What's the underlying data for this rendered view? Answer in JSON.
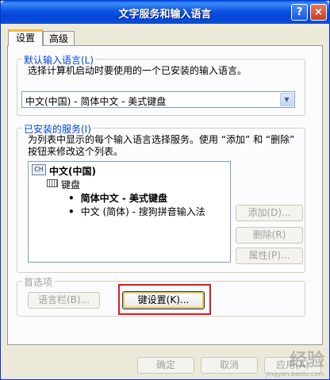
{
  "window": {
    "title": "文字服务和输入语言",
    "help_glyph": "?",
    "close_glyph": "×"
  },
  "tabs": [
    {
      "label": "设置"
    },
    {
      "label": "高级"
    }
  ],
  "default_language": {
    "legend": "默认输入语言(L)",
    "description": "选择计算机启动时要使用的一个已安装的输入语言。",
    "selected": "中文(中国) - 简体中文 - 美式键盘",
    "dropdown_glyph": "▼"
  },
  "installed_services": {
    "legend": "已安装的服务(I)",
    "description": "为列表中显示的每个输入语言选择服务。使用 “添加” 和 “删除” 按钮来修改这个列表。",
    "tree": {
      "language_code": "CH",
      "language": "中文(中国)",
      "category": "键盘",
      "items": [
        {
          "bullet": "•",
          "label": "简体中文 - 美式键盘"
        },
        {
          "bullet": "•",
          "label": "中文 (简体) - 搜狗拼音输入法"
        }
      ]
    },
    "buttons": {
      "add": "添加(D)...",
      "remove": "删除(R)",
      "properties": "属性(P)..."
    }
  },
  "preferences": {
    "legend": "首选项",
    "language_bar": "语言栏(B)...",
    "key_settings": "键设置(K)..."
  },
  "footer": {
    "ok": "确定",
    "cancel": "取消",
    "apply": "应用(A)"
  },
  "watermark": {
    "main": "经验",
    "sub": "jingyan.baidu.com"
  }
}
